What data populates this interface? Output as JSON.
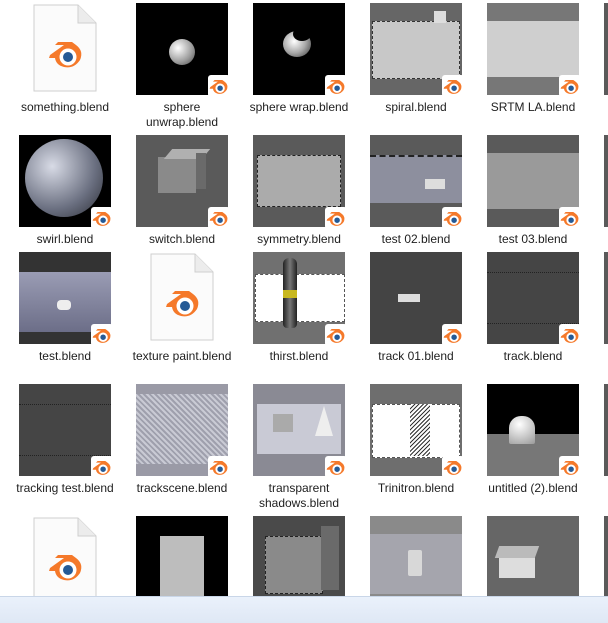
{
  "files": [
    {
      "label": "something.blend",
      "style": "doc"
    },
    {
      "label": "sphere unwrap.blend",
      "style": "sphere"
    },
    {
      "label": "sphere wrap.blend",
      "style": "spherewrap"
    },
    {
      "label": "spiral.blend",
      "style": "spiral"
    },
    {
      "label": "SRTM LA.blend",
      "style": "srtm"
    },
    {
      "label": "swirl.blend",
      "style": "swirl"
    },
    {
      "label": "switch.blend",
      "style": "cube"
    },
    {
      "label": "symmetry.blend",
      "style": "flat"
    },
    {
      "label": "test 02.blend",
      "style": "chain"
    },
    {
      "label": "test 03.blend",
      "style": "flat2"
    },
    {
      "label": "test.blend",
      "style": "floor"
    },
    {
      "label": "texture paint.blend",
      "style": "doc"
    },
    {
      "label": "thirst.blend",
      "style": "bottle"
    },
    {
      "label": "track 01.blend",
      "style": "track"
    },
    {
      "label": "track.blend",
      "style": "darkgray"
    },
    {
      "label": "tracking test.blend",
      "style": "darkgray"
    },
    {
      "label": "trackscene.blend",
      "style": "scene"
    },
    {
      "label": "transparent shadows.blend",
      "style": "shadows"
    },
    {
      "label": "Trinitron.blend",
      "style": "trinitron"
    },
    {
      "label": "untitled (2).blend",
      "style": "untitled"
    },
    {
      "label": "",
      "style": "doc"
    },
    {
      "label": "",
      "style": "panel"
    },
    {
      "label": "",
      "style": "bigcube"
    },
    {
      "label": "",
      "style": "glass"
    },
    {
      "label": "",
      "style": "house"
    }
  ],
  "colors": {
    "blender_orange": "#f5792a",
    "blender_blue": "#255a96"
  }
}
